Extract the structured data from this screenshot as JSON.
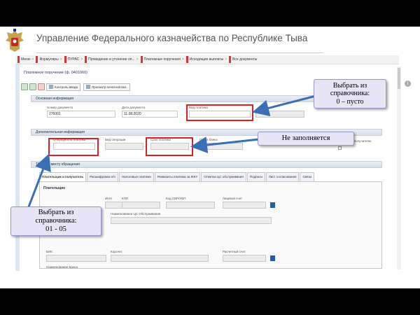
{
  "slide": {
    "title": "Управление Федерального казначейства по Республике Тыва"
  },
  "app": {
    "menu": [
      "Меню",
      "Формуляры",
      "ПУРАС",
      "Проведение и утонение оп...",
      "Платежные поручения",
      "Исходящие выплаты",
      "Все документы"
    ],
    "document_title": "Платежное поручение (ф. 0401060)",
    "toolbar": {
      "control_button": "Контроль ввода",
      "print_preview_button": "Просмотр печатной вкл."
    },
    "section_main": "Основная информация",
    "fields_main": {
      "doc_number_label": "Номер документа",
      "doc_number_value": "276001",
      "doc_date_label": "Дата документа",
      "doc_date_value": "11.08.2020",
      "payment_type_label": "Вид платежа"
    },
    "section_additional": "Дополнительная информация",
    "fields_additional": {
      "operation_type_label": "Вид операции",
      "payment_term_label": "Срок платежа",
      "payment_urgency_label": "Очередность платежа",
      "bank_label_1": "Пачка банка",
      "kbk_label": "КБК по получателю"
    },
    "section_tofk": "ТОФК по месту обращения",
    "tabs": [
      "Плательщик и получатель",
      "Расшифровка п/п",
      "Налоговые платежи",
      "Реквизиты платежа за ЖКУ",
      "Отметки ЦС обслуживания",
      "Подписи",
      "Лист согласования",
      "Связи"
    ],
    "payer": {
      "header": "Плательщик",
      "inn_label": "ИНН",
      "kpp_label": "КПП",
      "code_label": "Код СВР/УБП",
      "account_label": "Лицевой счет",
      "fo_label": "Наименование ЦС Обслуживания",
      "bik_label": "БИК",
      "corr_label": "Корсчет",
      "settle_label": "Расчетный счет",
      "bank_name_label": "Наименование Банка"
    }
  },
  "callouts": {
    "payment_type": [
      "Выбрать из",
      "справочника:",
      "0 – пусто"
    ],
    "not_filled": "Не заполняется",
    "directory": [
      "Выбрать из",
      "справочника:",
      "01 - 05"
    ]
  },
  "colors": {
    "highlight_box": "#e02020",
    "arrow": "#3a6fb5",
    "callout_bg": "#e6e4f5"
  }
}
